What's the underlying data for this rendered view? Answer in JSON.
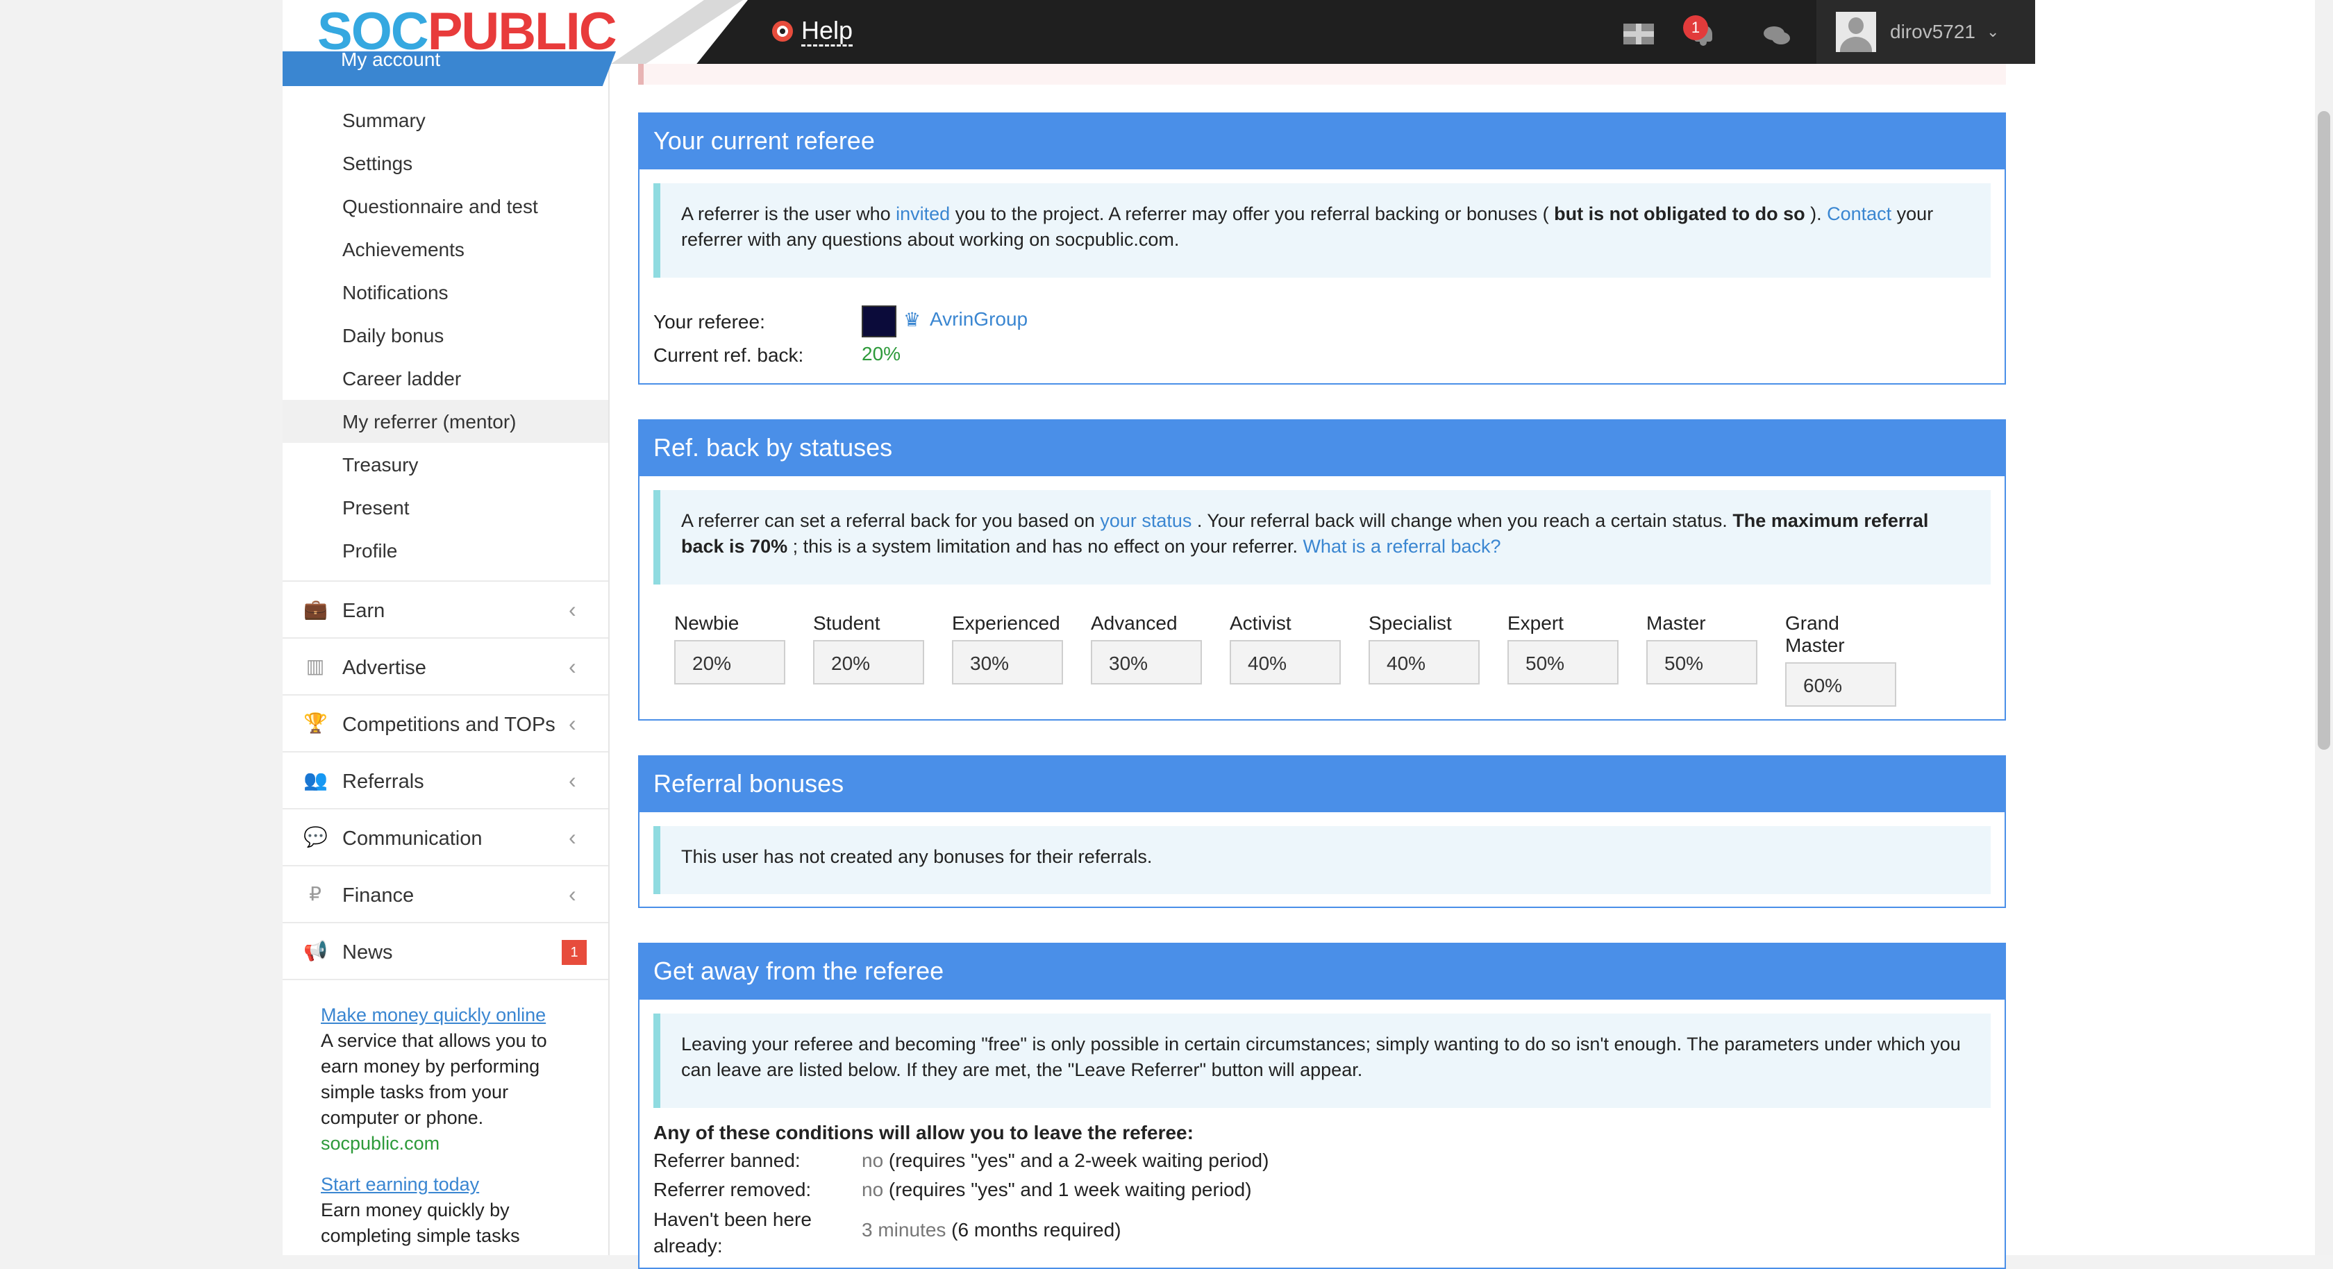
{
  "header": {
    "logo_soc": "SOC",
    "logo_public": "PUBLIC",
    "help_label": "Help",
    "notification_count": "1",
    "username": "dirov5721"
  },
  "sidebar": {
    "section_label": "My account",
    "sub_items": [
      {
        "label": "Summary"
      },
      {
        "label": "Settings"
      },
      {
        "label": "Questionnaire and test"
      },
      {
        "label": "Achievements"
      },
      {
        "label": "Notifications"
      },
      {
        "label": "Daily bonus"
      },
      {
        "label": "Career ladder"
      },
      {
        "label": "My referrer (mentor)",
        "active": true
      },
      {
        "label": "Treasury"
      },
      {
        "label": "Present"
      },
      {
        "label": "Profile"
      }
    ],
    "menu_items": [
      {
        "label": "Earn",
        "icon": "briefcase-icon"
      },
      {
        "label": "Advertise",
        "icon": "bar-chart-icon"
      },
      {
        "label": "Competitions and TOPs",
        "icon": "trophy-icon"
      },
      {
        "label": "Referrals",
        "icon": "users-icon"
      },
      {
        "label": "Communication",
        "icon": "chat-icon"
      },
      {
        "label": "Finance",
        "icon": "ruble-icon"
      },
      {
        "label": "News",
        "icon": "megaphone-icon",
        "badge": "1"
      }
    ],
    "ads": [
      {
        "title": "Make money quickly online",
        "text": "A service that allows you to earn money by performing simple tasks from your computer or phone.",
        "domain": "socpublic.com"
      },
      {
        "title": "Start earning today",
        "text": "Earn money quickly by completing simple tasks"
      }
    ]
  },
  "current_referee": {
    "title": "Your current referee",
    "info_p1": "A referrer is the user who ",
    "info_link_invited": "invited",
    "info_p2": " you to the project. A referrer may offer you referral backing or bonuses ( ",
    "info_bold": "but is not obligated to do so",
    "info_p3": " ). ",
    "info_link_contact": "Contact",
    "info_p4": " your referrer with any questions about working on socpublic.com.",
    "referee_label": "Your referee:",
    "referee_name": "AvrinGroup",
    "ref_back_label": "Current ref. back:",
    "ref_back_value": "20%"
  },
  "ref_back_statuses": {
    "title": "Ref. back by statuses",
    "info_p1": "A referrer can set a referral back for you based on ",
    "info_link_status": "your status",
    "info_p2": " . Your referral back will change when you reach a certain status. ",
    "info_bold": "The maximum referral back is 70%",
    "info_p3": " ; this is a system limitation and has no effect on your referrer. ",
    "info_link_what": "What is a referral back?",
    "statuses": [
      {
        "name": "Newbie",
        "value": "20%"
      },
      {
        "name": "Student",
        "value": "20%"
      },
      {
        "name": "Experienced",
        "value": "30%"
      },
      {
        "name": "Advanced",
        "value": "30%"
      },
      {
        "name": "Activist",
        "value": "40%"
      },
      {
        "name": "Specialist",
        "value": "40%"
      },
      {
        "name": "Expert",
        "value": "50%"
      },
      {
        "name": "Master",
        "value": "50%"
      },
      {
        "name": "Grand Master",
        "value": "60%"
      }
    ]
  },
  "referral_bonuses": {
    "title": "Referral bonuses",
    "info": "This user has not created any bonuses for their referrals."
  },
  "get_away": {
    "title": "Get away from the referee",
    "info": "Leaving your referee and becoming \"free\" is only possible in certain circumstances; simply wanting to do so isn't enough. The parameters under which you can leave are listed below. If they are met, the \"Leave Referrer\" button will appear.",
    "conditions_heading": "Any of these conditions will allow you to leave the referee:",
    "conditions": [
      {
        "label": "Referrer banned:",
        "value": "no",
        "note": " (requires \"yes\" and a 2-week waiting period)"
      },
      {
        "label": "Referrer removed:",
        "value": "no",
        "note": " (requires \"yes\" and 1 week waiting period)"
      },
      {
        "label": "Haven't been here already:",
        "value": "3 minutes",
        "note": " (6 months required)"
      }
    ]
  }
}
